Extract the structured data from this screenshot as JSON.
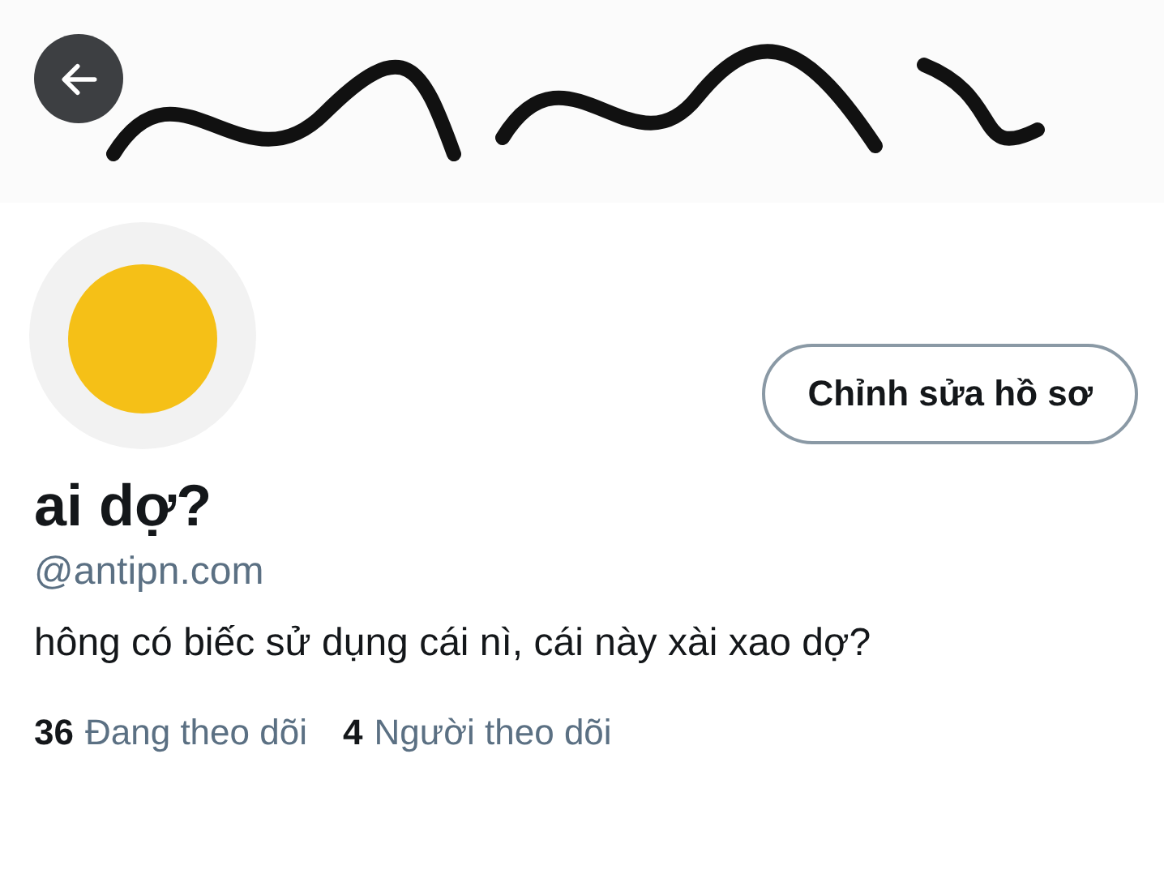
{
  "edit_profile_button": {
    "label": "Chỉnh sửa hồ sơ"
  },
  "profile": {
    "name": "ai dợ?",
    "handle": "@antipn.com",
    "bio": "hông có biếc sử dụng cái nì, cái này xài xao dợ?"
  },
  "stats": [
    {
      "count": "36",
      "label": "Đang theo dõi"
    },
    {
      "count": "4",
      "label": "Người theo dõi"
    }
  ]
}
